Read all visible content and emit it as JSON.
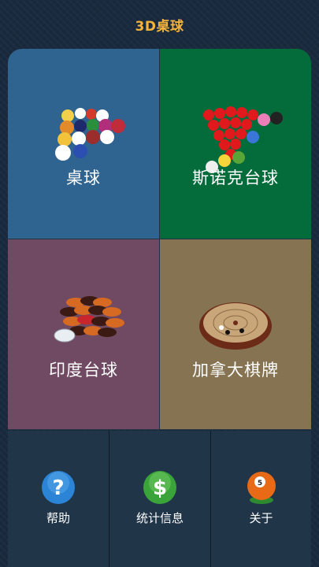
{
  "header": {
    "title": "3D桌球"
  },
  "tiles": [
    {
      "label": "桌球"
    },
    {
      "label": "斯诺克台球"
    },
    {
      "label": "印度台球"
    },
    {
      "label": "加拿大棋牌"
    }
  ],
  "bottom": [
    {
      "label": "帮助",
      "icon": "help-icon"
    },
    {
      "label": "统计信息",
      "icon": "dollar-icon"
    },
    {
      "label": "关于",
      "icon": "ball-5-icon"
    }
  ],
  "colors": {
    "title": "#f4b43a",
    "billiards_tile": "#2f6390",
    "snooker_tile": "#046b3a",
    "carrom_tile": "#6f4a62",
    "crokinole_tile": "#867352",
    "bottom_bar": "#213549"
  }
}
